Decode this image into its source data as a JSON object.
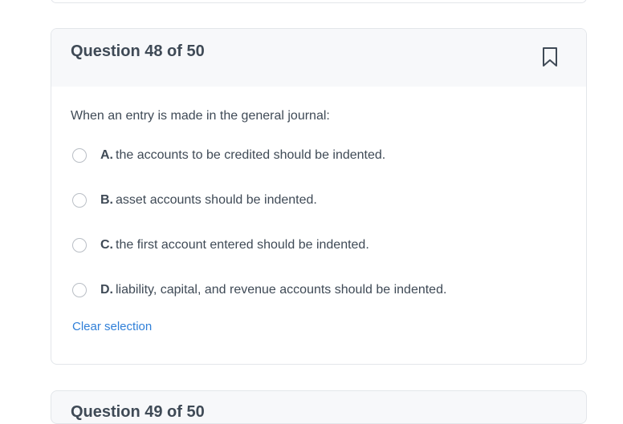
{
  "question": {
    "title": "Question 48 of 50",
    "prompt": "When an entry is made in the general journal:",
    "bookmark_icon": "bookmark-icon",
    "options": [
      {
        "letter": "A.",
        "text": "the accounts to be credited should be indented."
      },
      {
        "letter": "B.",
        "text": "asset accounts should be indented."
      },
      {
        "letter": "C.",
        "text": "the first account entered should be indented."
      },
      {
        "letter": "D.",
        "text": "liability, capital, and revenue accounts should be indented."
      }
    ],
    "clear_label": "Clear selection"
  },
  "next_question": {
    "title": "Question 49 of 50"
  },
  "colors": {
    "accent": "#2f7fd8",
    "header_bg": "#f7f8fa",
    "text": "#3f4a56",
    "border": "#e3e6ea"
  }
}
